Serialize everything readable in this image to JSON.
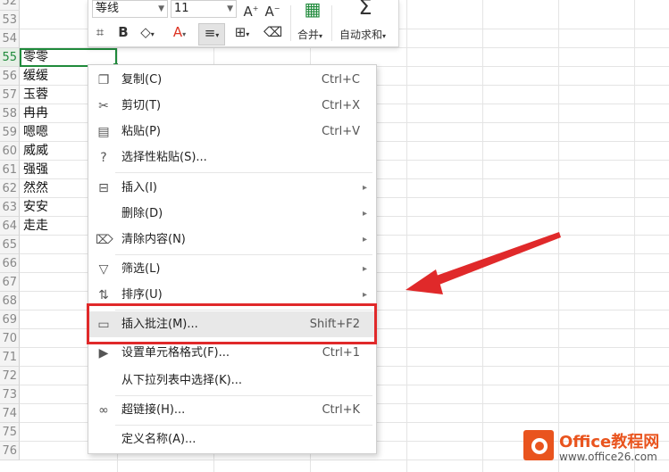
{
  "rows": [
    {
      "num": "52",
      "text": ""
    },
    {
      "num": "53",
      "text": ""
    },
    {
      "num": "54",
      "text": ""
    },
    {
      "num": "55",
      "text": "零零"
    },
    {
      "num": "56",
      "text": "缓缓"
    },
    {
      "num": "57",
      "text": "玉蓉"
    },
    {
      "num": "58",
      "text": "冉冉"
    },
    {
      "num": "59",
      "text": "嗯嗯"
    },
    {
      "num": "60",
      "text": "威威"
    },
    {
      "num": "61",
      "text": "强强"
    },
    {
      "num": "62",
      "text": "然然"
    },
    {
      "num": "63",
      "text": "安安"
    },
    {
      "num": "64",
      "text": "走走"
    },
    {
      "num": "65",
      "text": ""
    },
    {
      "num": "66",
      "text": ""
    },
    {
      "num": "67",
      "text": ""
    },
    {
      "num": "68",
      "text": ""
    },
    {
      "num": "69",
      "text": ""
    },
    {
      "num": "70",
      "text": ""
    },
    {
      "num": "71",
      "text": ""
    },
    {
      "num": "72",
      "text": ""
    },
    {
      "num": "73",
      "text": ""
    },
    {
      "num": "74",
      "text": ""
    },
    {
      "num": "75",
      "text": ""
    },
    {
      "num": "76",
      "text": ""
    }
  ],
  "toolbar": {
    "font_name": "等线",
    "font_size": "11",
    "merge_label": "合并",
    "autosum_label": "自动求和"
  },
  "menu": {
    "items": [
      {
        "label": "复制(C)",
        "shortcut": "Ctrl+C"
      },
      {
        "label": "剪切(T)",
        "shortcut": "Ctrl+X"
      },
      {
        "label": "粘贴(P)",
        "shortcut": "Ctrl+V"
      },
      {
        "label": "选择性粘贴(S)...",
        "shortcut": ""
      },
      {
        "label": "插入(I)",
        "shortcut": ""
      },
      {
        "label": "删除(D)",
        "shortcut": ""
      },
      {
        "label": "清除内容(N)",
        "shortcut": ""
      },
      {
        "label": "筛选(L)",
        "shortcut": ""
      },
      {
        "label": "排序(U)",
        "shortcut": ""
      },
      {
        "label": "插入批注(M)...",
        "shortcut": "Shift+F2"
      },
      {
        "label": "设置单元格格式(F)...",
        "shortcut": "Ctrl+1"
      },
      {
        "label": "从下拉列表中选择(K)...",
        "shortcut": ""
      },
      {
        "label": "超链接(H)...",
        "shortcut": "Ctrl+K"
      },
      {
        "label": "定义名称(A)...",
        "shortcut": ""
      }
    ]
  },
  "watermark": {
    "brand": "Office教程网",
    "site": "www.office26.com"
  },
  "colors": {
    "selection": "#1f8a3b",
    "highlight_box": "#e0292a",
    "brand": "#e9541e"
  }
}
